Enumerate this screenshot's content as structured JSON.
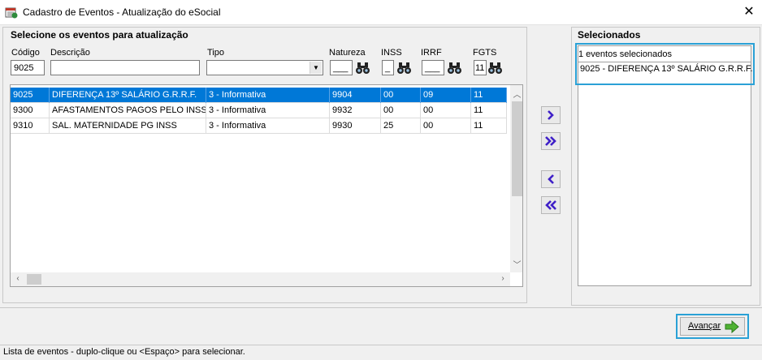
{
  "window": {
    "title": "Cadastro de Eventos - Atualização do eSocial",
    "close_label": "✕"
  },
  "left_group": {
    "title": "Selecione os eventos para atualização",
    "filters": {
      "codigo_label": "Código",
      "codigo_value": "9025",
      "descricao_label": "Descrição",
      "descricao_value": "",
      "tipo_label": "Tipo",
      "tipo_value": "",
      "natureza_label": "Natureza",
      "natureza_value": "___",
      "inss_label": "INSS",
      "inss_value": "_",
      "irrf_label": "IRRF",
      "irrf_value": "___",
      "fgts_label": "FGTS",
      "fgts_value": "11"
    },
    "rows": [
      {
        "codigo": "9025",
        "descricao": "DIFERENÇA 13º SALÁRIO G.R.R.F.",
        "tipo": "3 - Informativa",
        "natureza": "9904",
        "inss": "00",
        "irrf": "09",
        "fgts": "11",
        "selected": true
      },
      {
        "codigo": "9300",
        "descricao": "AFASTAMENTOS PAGOS PELO INSS",
        "tipo": "3 - Informativa",
        "natureza": "9932",
        "inss": "00",
        "irrf": "00",
        "fgts": "11",
        "selected": false
      },
      {
        "codigo": "9310",
        "descricao": "SAL. MATERNIDADE PG INSS",
        "tipo": "3 - Informativa",
        "natureza": "9930",
        "inss": "25",
        "irrf": "00",
        "fgts": "11",
        "selected": false
      }
    ]
  },
  "right_group": {
    "title": "Selecionados",
    "count_text": "1 eventos selecionados",
    "items": [
      "9025 - DIFERENÇA 13º SALÁRIO G.R.R.F."
    ]
  },
  "footer": {
    "advance_label": "Avançar",
    "status_text": "Lista de eventos - duplo-clique ou <Espaço> para selecionar."
  },
  "colors": {
    "selection": "#0078d7",
    "highlight_outline": "#2aa1d6",
    "move_arrow": "#3f20c8",
    "advance_arrow": "#4fb233"
  }
}
